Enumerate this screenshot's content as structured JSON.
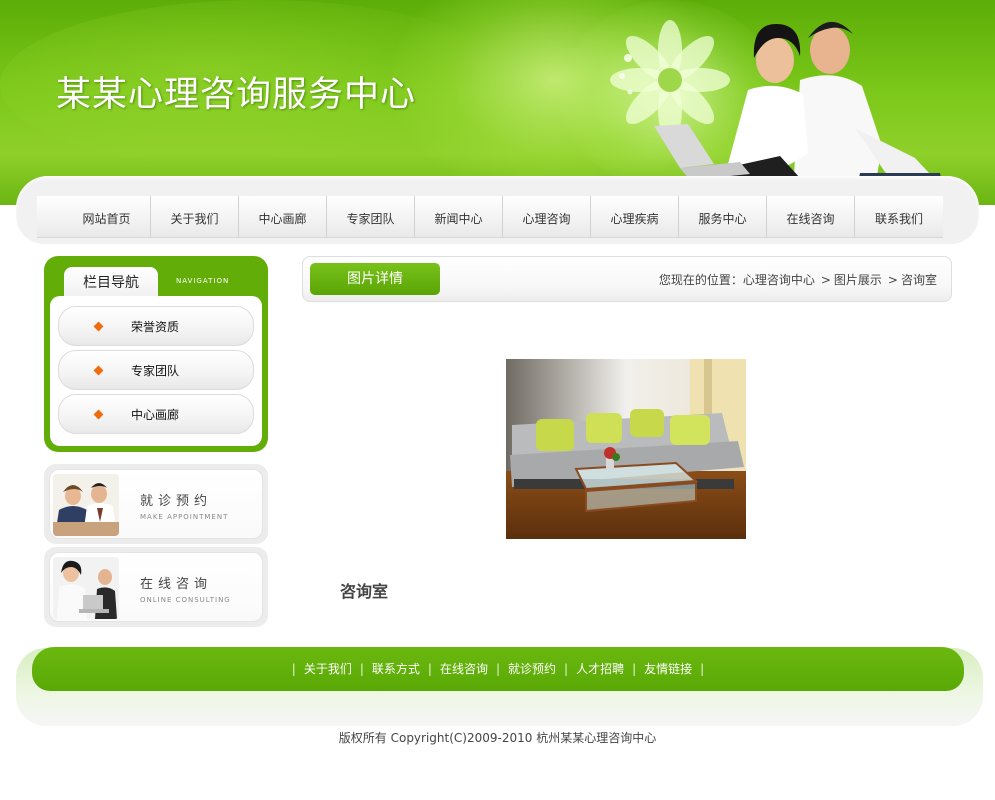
{
  "header": {
    "site_title": "某某心理咨询服务中心"
  },
  "nav": {
    "items": [
      "网站首页",
      "关于我们",
      "中心画廊",
      "专家团队",
      "新闻中心",
      "心理咨询",
      "心理疾病",
      "服务中心",
      "在线咨询",
      "联系我们"
    ]
  },
  "sidebar": {
    "title": "栏目导航",
    "title_en": "NAVIGATION",
    "items": [
      "荣誉资质",
      "专家团队",
      "中心画廊"
    ]
  },
  "promos": [
    {
      "title": "就诊预约",
      "subtitle": "MAKE APPOINTMENT"
    },
    {
      "title": "在线咨询",
      "subtitle": "ONLINE CONSULTING"
    }
  ],
  "main": {
    "section_title": "图片详情",
    "breadcrumb": {
      "prefix": "您现在的位置：",
      "home": "心理咨询中心",
      "sep": ">",
      "level1": "图片展示",
      "current": "咨询室"
    },
    "photo_caption": "咨询室"
  },
  "footer": {
    "links": [
      "关于我们",
      "联系方式",
      "在线咨询",
      "就诊预约",
      "人才招聘",
      "友情链接"
    ],
    "separator": "|",
    "copyright": "版权所有  Copyright(C)2009-2010 杭州某某心理咨询中心"
  },
  "colors": {
    "brand_green": "#63ad09",
    "accent_orange": "#ef6b10"
  }
}
